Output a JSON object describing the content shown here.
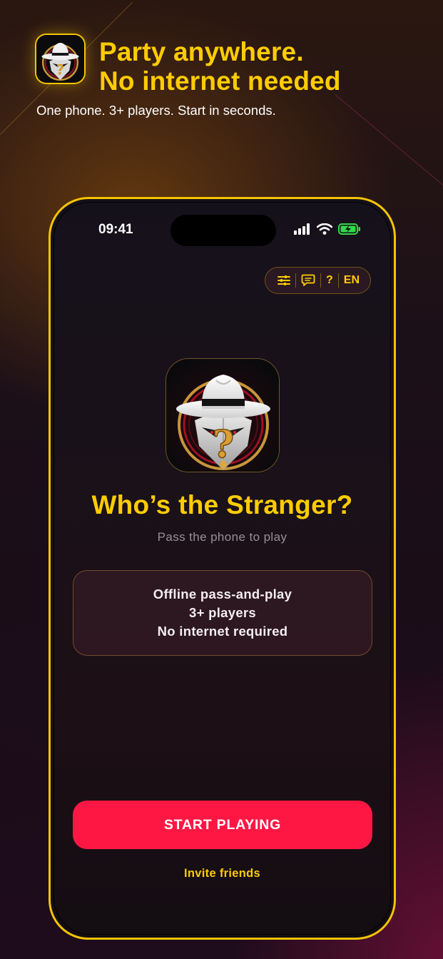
{
  "promo": {
    "headline_line1": "Party anywhere.",
    "headline_line2": "No internet needed",
    "subline": "One phone. 3+ players. Start in seconds."
  },
  "status_bar": {
    "time": "09:41",
    "icons": [
      "signal-icon",
      "wifi-icon",
      "battery-charging-icon"
    ]
  },
  "toolbar": {
    "settings_icon": "sliders-icon",
    "feedback_icon": "chat-bubble-icon",
    "help_label": "?",
    "language_label": "EN"
  },
  "game": {
    "title": "Who’s the Stranger?",
    "subtitle": "Pass the phone to play",
    "features": [
      "Offline pass-and-play",
      "3+ players",
      "No internet required"
    ],
    "start_label": "START PLAYING",
    "invite_label": "Invite friends"
  },
  "colors": {
    "accent_yellow": "#ffcc00",
    "start_red": "#ff1744",
    "frame_yellow": "#f5c400"
  }
}
